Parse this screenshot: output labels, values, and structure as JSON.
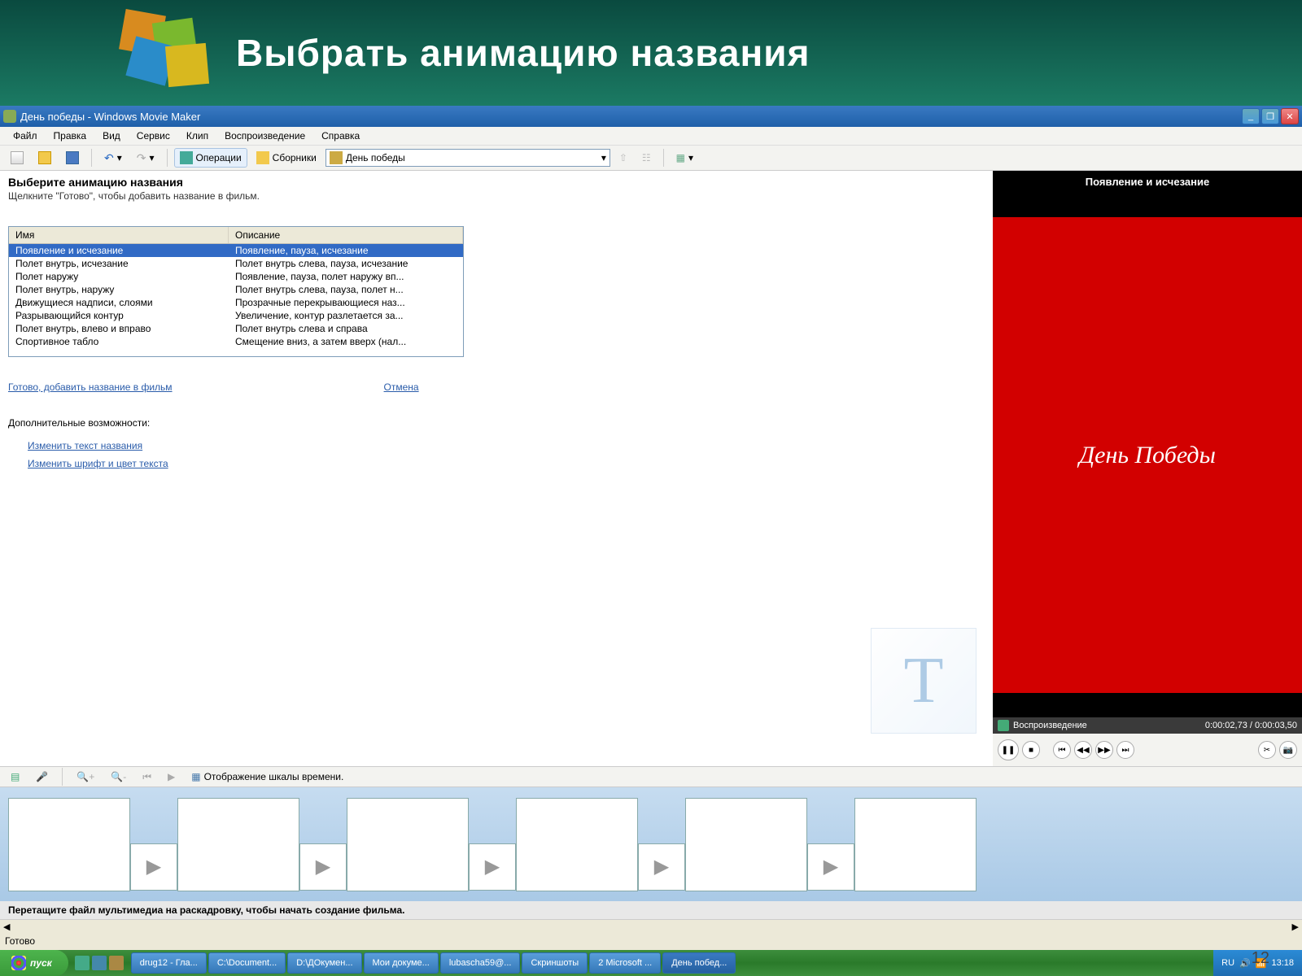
{
  "slide": {
    "title": "Выбрать анимацию названия",
    "page_number": "12"
  },
  "window": {
    "title": "День победы - Windows Movie Maker"
  },
  "menu": {
    "file": "Файл",
    "edit": "Правка",
    "view": "Вид",
    "tools": "Сервис",
    "clip": "Клип",
    "play": "Воспроизведение",
    "help": "Справка"
  },
  "toolbar": {
    "operations": "Операции",
    "collections": "Сборники",
    "location": "День победы"
  },
  "task": {
    "title": "Выберите анимацию названия",
    "sub": "Щелкните \"Готово\", чтобы добавить название в фильм.",
    "col_name": "Имя",
    "col_desc": "Описание",
    "rows": [
      {
        "name": "Появление и исчезание",
        "desc": "Появление, пауза, исчезание"
      },
      {
        "name": "Полет внутрь, исчезание",
        "desc": "Полет внутрь слева, пауза, исчезание"
      },
      {
        "name": "Полет наружу",
        "desc": "Появление, пауза, полет наружу вп..."
      },
      {
        "name": "Полет внутрь, наружу",
        "desc": "Полет внутрь слева, пауза, полет н..."
      },
      {
        "name": "Движущиеся надписи, слоями",
        "desc": "Прозрачные перекрывающиеся наз..."
      },
      {
        "name": "Разрывающийся контур",
        "desc": "Увеличение, контур разлетается за..."
      },
      {
        "name": "Полет внутрь, влево и вправо",
        "desc": "Полет внутрь слева и справа"
      },
      {
        "name": "Спортивное табло",
        "desc": "Смещение вниз, а затем вверх (нал..."
      }
    ],
    "done_link": "Готово, добавить название в фильм",
    "cancel_link": "Отмена",
    "more_title": "Дополнительные возможности:",
    "edit_text": "Изменить текст названия",
    "edit_font": "Изменить шрифт и цвет текста"
  },
  "preview": {
    "effect": "Появление и исчезание",
    "title_text": "День Победы",
    "status": "Воспроизведение",
    "time": "0:00:02,73 / 0:00:03,50"
  },
  "timeline": {
    "show_timeline": "Отображение шкалы времени.",
    "hint": "Перетащите файл мультимедиа на раскадровку, чтобы начать создание фильма."
  },
  "statusbar": {
    "text": "Готово"
  },
  "taskbar": {
    "start": "пуск",
    "items": [
      "drug12 - Гла...",
      "C:\\Document...",
      "D:\\ДОкумен...",
      "Мои докуме...",
      "lubascha59@...",
      "Скриншоты",
      "2 Microsoft ...",
      "День побед..."
    ],
    "lang": "RU",
    "clock": "13:18"
  }
}
